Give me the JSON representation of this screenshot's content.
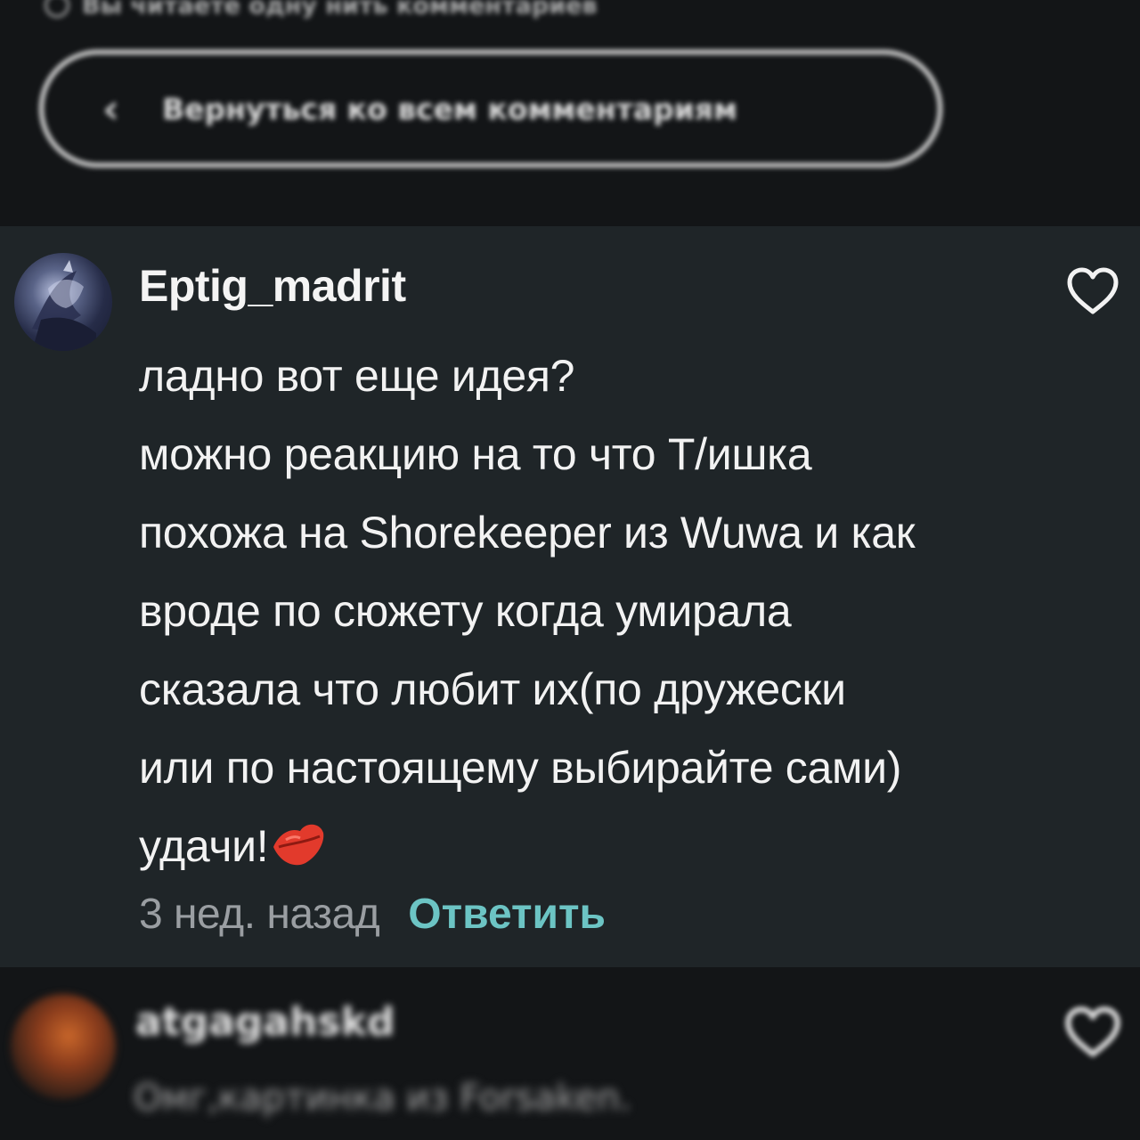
{
  "top_bar": {
    "thread_notice": "Вы читаете одну нить комментариев",
    "notice_icon": "history-icon",
    "back_button_label": "Вернуться ко всем комментариям",
    "back_icon": "chevron-left-icon"
  },
  "comment": {
    "username": "Eptig_madrit",
    "lines": [
      "ладно вот еще идея?",
      "можно реакцию на то что Т/ишка",
      "похожа на Shorekeeper из Wuwa и как",
      "вроде по сюжету когда умирала",
      "сказала что любит их(по дружески",
      "или по настоящему выбирайте сами)",
      "удачи!"
    ],
    "emoji": "kiss-mark-icon",
    "timestamp": "3 нед. назад",
    "reply_label": "Ответить",
    "like_icon": "heart-outline-icon"
  },
  "next_comment": {
    "username": "atgagahskd",
    "text": "Омг,картинка из Forsaken.",
    "like_icon": "heart-outline-icon"
  },
  "colors": {
    "background": "#121416",
    "highlight_card": "#1f2528",
    "reply_accent": "#6cc4c4",
    "timestamp": "#9a9ea2",
    "emoji_red": "#e23a2c"
  }
}
